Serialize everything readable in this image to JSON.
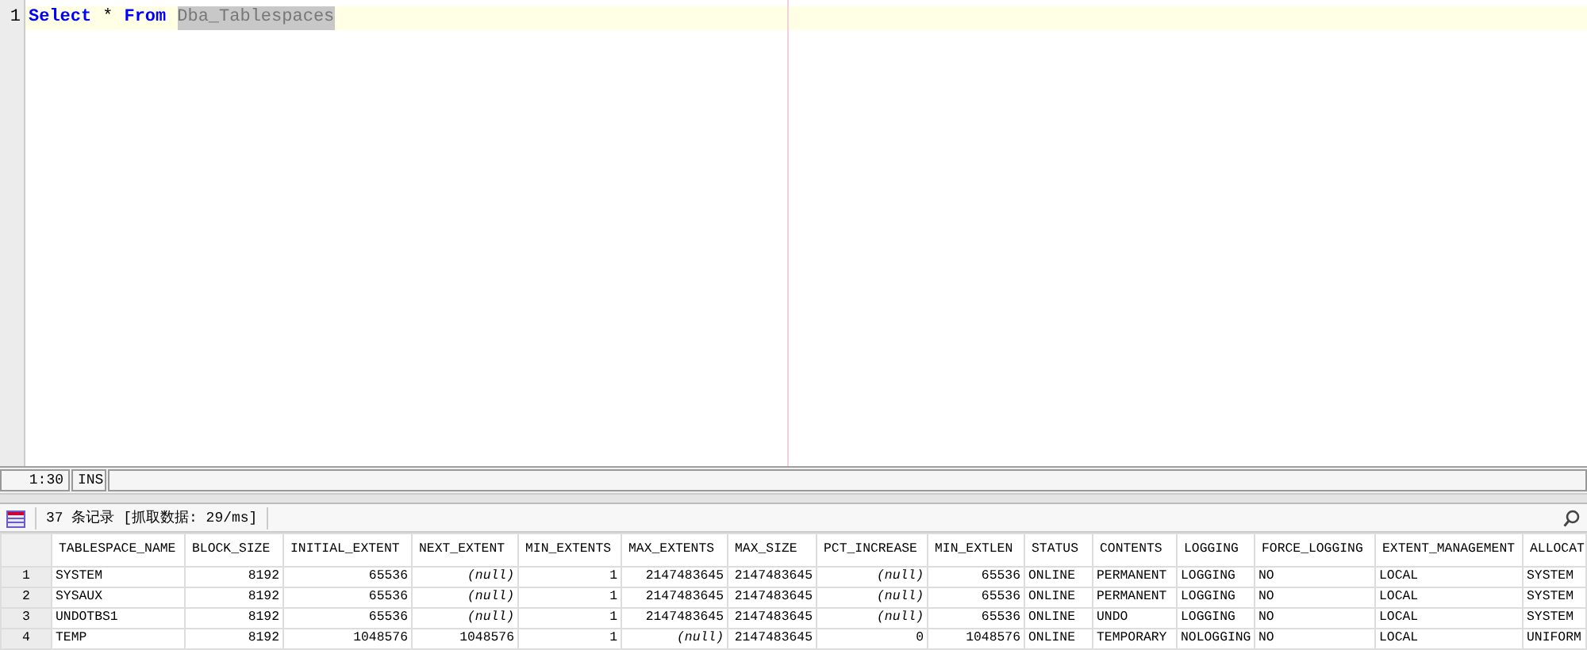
{
  "editor": {
    "lines": [
      {
        "number": "1",
        "tokens": [
          {
            "kind": "keyword",
            "text": "Select"
          },
          {
            "kind": "plain",
            "text": "*"
          },
          {
            "kind": "keyword",
            "text": "From"
          },
          {
            "kind": "selected",
            "text": "Dba_Tablespaces"
          }
        ]
      }
    ]
  },
  "status_bar": {
    "position": "1:30",
    "mode": "INS"
  },
  "results": {
    "summary": "37 条记录 [抓取数据: 29/ms]",
    "columns": [
      {
        "label": "TABLESPACE_NAME",
        "kind": "text"
      },
      {
        "label": "BLOCK_SIZE",
        "kind": "number"
      },
      {
        "label": "INITIAL_EXTENT",
        "kind": "number"
      },
      {
        "label": "NEXT_EXTENT",
        "kind": "number"
      },
      {
        "label": "MIN_EXTENTS",
        "kind": "number"
      },
      {
        "label": "MAX_EXTENTS",
        "kind": "number"
      },
      {
        "label": "MAX_SIZE",
        "kind": "number"
      },
      {
        "label": "PCT_INCREASE",
        "kind": "number"
      },
      {
        "label": "MIN_EXTLEN",
        "kind": "number"
      },
      {
        "label": "STATUS",
        "kind": "text"
      },
      {
        "label": "CONTENTS",
        "kind": "text"
      },
      {
        "label": "LOGGING",
        "kind": "text"
      },
      {
        "label": "FORCE_LOGGING",
        "kind": "text"
      },
      {
        "label": "EXTENT_MANAGEMENT",
        "kind": "text"
      },
      {
        "label": "ALLOCAT",
        "kind": "text"
      }
    ],
    "rows": [
      {
        "number": "1",
        "cells": [
          "SYSTEM",
          "8192",
          "65536",
          {
            "kind": "null",
            "text": "(null)"
          },
          "1",
          "2147483645",
          "2147483645",
          {
            "kind": "null",
            "text": "(null)"
          },
          "65536",
          "ONLINE",
          "PERMANENT",
          "LOGGING",
          "NO",
          "LOCAL",
          "SYSTEM"
        ]
      },
      {
        "number": "2",
        "cells": [
          "SYSAUX",
          "8192",
          "65536",
          {
            "kind": "null",
            "text": "(null)"
          },
          "1",
          "2147483645",
          "2147483645",
          {
            "kind": "null",
            "text": "(null)"
          },
          "65536",
          "ONLINE",
          "PERMANENT",
          "LOGGING",
          "NO",
          "LOCAL",
          "SYSTEM"
        ]
      },
      {
        "number": "3",
        "cells": [
          "UNDOTBS1",
          "8192",
          "65536",
          {
            "kind": "null",
            "text": "(null)"
          },
          "1",
          "2147483645",
          "2147483645",
          {
            "kind": "null",
            "text": "(null)"
          },
          "65536",
          "ONLINE",
          "UNDO",
          "LOGGING",
          "NO",
          "LOCAL",
          "SYSTEM"
        ]
      },
      {
        "number": "4",
        "cells": [
          "TEMP",
          "8192",
          "1048576",
          "1048576",
          "1",
          {
            "kind": "null",
            "text": "(null)"
          },
          "2147483645",
          "0",
          "1048576",
          "ONLINE",
          "TEMPORARY",
          "NOLOGGING",
          "NO",
          "LOCAL",
          "UNIFORM"
        ]
      }
    ]
  }
}
